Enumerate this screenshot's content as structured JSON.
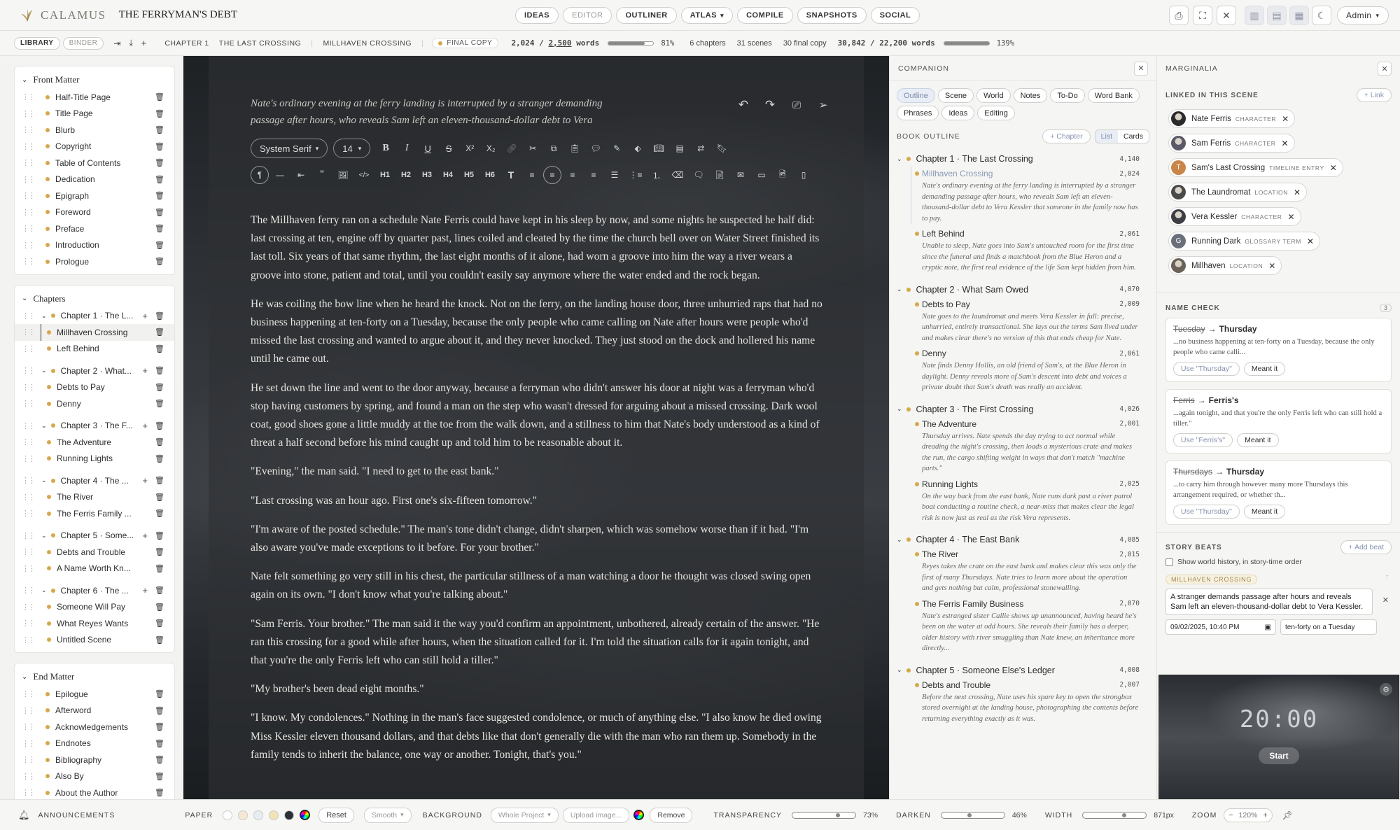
{
  "app": {
    "brand": "CALAMUS",
    "doc_title": "THE FERRYMAN'S DEBT",
    "user": "Admin"
  },
  "nav": {
    "ideas": "IDEAS",
    "editor": "EDITOR",
    "outliner": "OUTLINER",
    "atlas": "ATLAS",
    "compile": "COMPILE",
    "snapshots": "SNAPSHOTS",
    "social": "SOCIAL"
  },
  "status": {
    "library": "LIBRARY",
    "binder": "BINDER",
    "chapter": "CHAPTER 1",
    "chapter_name": "THE LAST CROSSING",
    "scene": "MILLHAVEN CROSSING",
    "final_copy": "FINAL COPY",
    "words": "2,024",
    "target": "2,500",
    "words_unit": "words",
    "scene_progress": 0.81,
    "scene_pct": "81%",
    "chapters": "6 chapters",
    "scenes": "31 scenes",
    "final": "30 final copy",
    "total_words": "30,842",
    "total_target": "22,200",
    "total_unit": "words",
    "total_progress": 1.0,
    "total_pct": "139%"
  },
  "binder": {
    "front_matter": {
      "title": "Front Matter",
      "items": [
        "Half-Title Page",
        "Title Page",
        "Blurb",
        "Copyright",
        "Table of Contents",
        "Dedication",
        "Epigraph",
        "Foreword",
        "Preface",
        "Introduction",
        "Prologue"
      ]
    },
    "chapters_title": "Chapters",
    "chapters": [
      {
        "label": "Chapter 1 · The L...",
        "scenes": [
          "Millhaven Crossing",
          "Left Behind"
        ]
      },
      {
        "label": "Chapter 2 · What...",
        "scenes": [
          "Debts to Pay",
          "Denny"
        ]
      },
      {
        "label": "Chapter 3 · The F...",
        "scenes": [
          "The Adventure",
          "Running Lights"
        ]
      },
      {
        "label": "Chapter 4 · The ...",
        "scenes": [
          "The River",
          "The Ferris Family ..."
        ]
      },
      {
        "label": "Chapter 5 · Some...",
        "scenes": [
          "Debts and Trouble",
          "A Name Worth Kn..."
        ]
      },
      {
        "label": "Chapter 6 · The ...",
        "scenes": [
          "Someone Will Pay",
          "What Reyes Wants",
          "Untitled Scene"
        ]
      }
    ],
    "end_matter": {
      "title": "End Matter",
      "items": [
        "Epilogue",
        "Afterword",
        "Acknowledgements",
        "Endnotes",
        "Bibliography",
        "Also By",
        "About the Author"
      ]
    }
  },
  "editor": {
    "synopsis": "Nate's ordinary evening at the ferry landing is interrupted by a stranger demanding passage after hours, who reveals Sam left an eleven-thousand-dollar debt to Vera",
    "font": "System Serif",
    "size": "14",
    "paragraphs": [
      "The Millhaven ferry ran on a schedule Nate Ferris could have kept in his sleep by now, and some nights he suspected he half did: last crossing at ten, engine off by quarter past, lines coiled and cleated by the time the church bell over on Water Street finished its last toll. Six years of that same rhythm, the last eight months of it alone, had worn a groove into him the way a river wears a groove into stone, patient and total, until you couldn't easily say anymore where the water ended and the rock began.",
      "He was coiling the bow line when he heard the knock. Not on the ferry, on the landing house door, three unhurried raps that had no business happening at ten-forty on a Tuesday, because the only people who came calling on Nate after hours were people who'd missed the last crossing and wanted to argue about it, and they never knocked. They just stood on the dock and hollered his name until he came out.",
      "He set down the line and went to the door anyway, because a ferryman who didn't answer his door at night was a ferryman who'd stop having customers by spring, and found a man on the step who wasn't dressed for arguing about a missed crossing. Dark wool coat, good shoes gone a little muddy at the toe from the walk down, and a stillness to him that Nate's body understood as a kind of threat a half second before his mind caught up and told him to be reasonable about it.",
      "\"Evening,\" the man said. \"I need to get to the east bank.\"",
      "\"Last crossing was an hour ago. First one's six-fifteen tomorrow.\"",
      "\"I'm aware of the posted schedule.\" The man's tone didn't change, didn't sharpen, which was somehow worse than if it had. \"I'm also aware you've made exceptions to it before. For your brother.\"",
      "Nate felt something go very still in his chest, the particular stillness of a man watching a door he thought was closed swing open again on its own. \"I don't know what you're talking about.\"",
      "\"Sam Ferris. Your brother.\" The man said it the way you'd confirm an appointment, unbothered, already certain of the answer. \"He ran this crossing for a good while after hours, when the situation called for it. I'm told the situation calls for it again tonight, and that you're the only Ferris left who can still hold a tiller.\"",
      "\"My brother's been dead eight months.\"",
      "\"I know. My condolences.\" Nothing in the man's face suggested condolence, or much of anything else. \"I also know he died owing Miss Kessler eleven thousand dollars, and that debts like that don't generally die with the man who ran them up. Somebody in the family tends to inherit the balance, one way or another. Tonight, that's you.\""
    ]
  },
  "companion": {
    "title": "COMPANION",
    "tabs": [
      "Outline",
      "Scene",
      "World",
      "Notes",
      "To-Do",
      "Word Bank",
      "Phrases",
      "Ideas",
      "Editing"
    ],
    "outline_title": "BOOK OUTLINE",
    "add_chapter": "+ Chapter",
    "view_list": "List",
    "view_cards": "Cards",
    "chapters": [
      {
        "title": "Chapter 1 · The Last Crossing",
        "wc": "4,140",
        "scenes": [
          {
            "t": "Millhaven Crossing",
            "wc": "2,024",
            "d": "Nate's ordinary evening at the ferry landing is interrupted by a stranger demanding passage after hours, who reveals Sam left an eleven-thousand-dollar debt to Vera Kessler that someone in the family now has to pay."
          },
          {
            "t": "Left Behind",
            "wc": "2,061",
            "d": "Unable to sleep, Nate goes into Sam's untouched room for the first time since the funeral and finds a matchbook from the Blue Heron and a cryptic note, the first real evidence of the life Sam kept hidden from him."
          }
        ]
      },
      {
        "title": "Chapter 2 · What Sam Owed",
        "wc": "4,070",
        "scenes": [
          {
            "t": "Debts to Pay",
            "wc": "2,009",
            "d": "Nate goes to the laundromat and meets Vera Kessler in full: precise, unhurried, entirely transactional. She lays out the terms Sam lived under and makes clear there's no version of this that ends cheap for Nate."
          },
          {
            "t": "Denny",
            "wc": "2,061",
            "d": "Nate finds Denny Hollis, an old friend of Sam's, at the Blue Heron in daylight. Denny reveals more of Sam's descent into debt and voices a private doubt that Sam's death was really an accident."
          }
        ]
      },
      {
        "title": "Chapter 3 · The First Crossing",
        "wc": "4,026",
        "scenes": [
          {
            "t": "The Adventure",
            "wc": "2,001",
            "d": "Thursday arrives. Nate spends the day trying to act normal while dreading the night's crossing, then loads a mysterious crate and makes the run, the cargo shifting weight in ways that don't match \"machine parts.\""
          },
          {
            "t": "Running Lights",
            "wc": "2,025",
            "d": "On the way back from the east bank, Nate runs dark past a river patrol boat conducting a routine check, a near-miss that makes clear the legal risk is now just as real as the risk Vera represents."
          }
        ]
      },
      {
        "title": "Chapter 4 · The East Bank",
        "wc": "4,085",
        "scenes": [
          {
            "t": "The River",
            "wc": "2,015",
            "d": "Reyes takes the crate on the east bank and makes clear this was only the first of many Thursdays. Nate tries to learn more about the operation and gets nothing but calm, professional stonewalling."
          },
          {
            "t": "The Ferris Family Business",
            "wc": "2,070",
            "d": "Nate's estranged sister Callie shows up unannounced, having heard he's been on the water at odd hours. She reveals their family has a deeper, older history with river smuggling than Nate knew, an inheritance more directly..."
          }
        ]
      },
      {
        "title": "Chapter 5 · Someone Else's Ledger",
        "wc": "4,008",
        "scenes": [
          {
            "t": "Debts and Trouble",
            "wc": "2,007",
            "d": "Before the next crossing, Nate uses his spare key to open the strongbox stored overnight at the landing house, photographing the contents before returning everything exactly as it was."
          }
        ]
      }
    ]
  },
  "marginalia": {
    "title": "MARGINALIA",
    "linked_title": "LINKED IN THIS SCENE",
    "link_btn": "+ Link",
    "links": [
      {
        "name": "Nate Ferris",
        "kind": "CHARACTER",
        "color": "#2b2b2b"
      },
      {
        "name": "Sam Ferris",
        "kind": "CHARACTER",
        "color": "#5a5a66"
      },
      {
        "name": "Sam's Last Crossing",
        "kind": "TIMELINE ENTRY",
        "color": "#c9854a",
        "initial": "T"
      },
      {
        "name": "The Laundromat",
        "kind": "LOCATION",
        "color": "#4a4a4a"
      },
      {
        "name": "Vera Kessler",
        "kind": "CHARACTER",
        "color": "#3d3d44"
      },
      {
        "name": "Running Dark",
        "kind": "GLOSSARY TERM",
        "color": "#6a6f7a",
        "initial": "G"
      },
      {
        "name": "Millhaven",
        "kind": "LOCATION",
        "color": "#6b6257"
      }
    ],
    "name_check_title": "NAME CHECK",
    "name_check_count": "3",
    "checks": [
      {
        "from": "Tuesday",
        "to": "Thursday",
        "ctx": "...no business happening at ten-forty on a Tuesday, because the only people who came calli...",
        "use": "Use \"Thursday\"",
        "meant": "Meant it"
      },
      {
        "from": "Ferris",
        "to": "Ferris's",
        "ctx": "...again tonight, and that you're the only Ferris left who can still hold a tiller.\"",
        "use": "Use \"Ferris's\"",
        "meant": "Meant it"
      },
      {
        "from": "Thursdays",
        "to": "Thursday",
        "ctx": "...to carry him through however many more Thursdays this arrangement required, or whether th...",
        "use": "Use \"Thursday\"",
        "meant": "Meant it"
      }
    ],
    "beats_title": "STORY BEATS",
    "add_beat": "+ Add beat",
    "show_history": "Show world history, in story-time order",
    "beat_tag": "MILLHAVEN CROSSING",
    "beat_text": "A stranger demands passage after hours and reveals Sam left an eleven-thousand-dollar debt to Vera Kessler.",
    "beat_date": "09/02/2025, 10:40 PM",
    "beat_time": "ten-forty on a Tuesday",
    "timer": "20:00",
    "timer_btn": "Start"
  },
  "bottom": {
    "announcements": "ANNOUNCEMENTS",
    "paper": "PAPER",
    "reset": "Reset",
    "smooth": "Smooth",
    "background": "BACKGROUND",
    "scope": "Whole Project",
    "upload": "Upload image...",
    "remove": "Remove",
    "transparency": "TRANSPARENCY",
    "transparency_val": "73%",
    "transparency_level": 0.73,
    "darken": "DARKEN",
    "darken_val": "46%",
    "darken_level": 0.46,
    "width": "WIDTH",
    "width_val": "871px",
    "zoom": "ZOOM",
    "zoom_val": "120%",
    "paper_colors": [
      "#ffffff",
      "#f7e8d6",
      "#e6eef3",
      "#f1e3b5",
      "#2b2f36"
    ]
  }
}
